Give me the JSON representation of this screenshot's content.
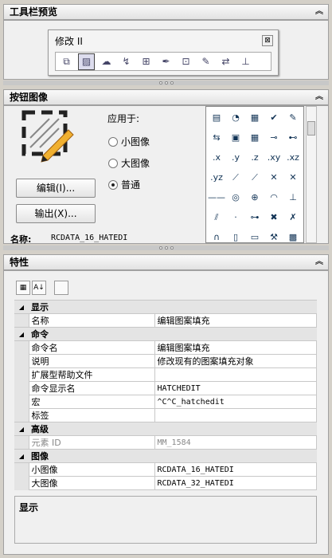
{
  "toolbar_preview": {
    "header": "工具栏预览",
    "window_title": "修改 II",
    "close_glyph": "⊠",
    "icons": [
      "draworder-icon",
      "edit-hatch-icon",
      "edit-polyline-icon",
      "edit-spline-icon",
      "edit-array-icon",
      "edit-text-icon",
      "edit-block-icon",
      "edit-attribute-icon",
      "sync-attribute-icon",
      "attribute-manager-icon"
    ]
  },
  "button_image": {
    "header": "按钮图像",
    "apply_to": "应用于:",
    "radios": [
      "小图像",
      "大图像",
      "普通"
    ],
    "selected": 2,
    "edit_button": "编辑(I)...",
    "export_button": "输出(X)...",
    "name_label": "名称:",
    "name_value": "RCDATA_16_HATEDI",
    "grid": [
      "▤",
      "◔",
      "▦",
      "✔",
      "✎",
      "⇆",
      "▣",
      "▦",
      "⊸",
      "⊷",
      ".x",
      ".y",
      ".z",
      ".xy",
      ".xz",
      ".yz",
      "⟋",
      "⟋",
      "✕",
      "✕",
      "——",
      "◎",
      "⊕",
      "◠",
      "⊥",
      "⫽",
      "·",
      "⊶",
      "✖",
      "✗",
      "∩",
      "▯",
      "▭",
      "⚒",
      "▩"
    ]
  },
  "properties": {
    "header": "特性",
    "sort_labels": [
      "▦",
      "A↓",
      ""
    ],
    "rows": [
      {
        "cat": true,
        "name": "显示"
      },
      {
        "name": "名称",
        "value": "编辑图案填充"
      },
      {
        "cat": true,
        "name": "命令"
      },
      {
        "name": "命令名",
        "value": "编辑图案填充"
      },
      {
        "name": "说明",
        "value": "修改现有的图案填充对象"
      },
      {
        "name": "扩展型帮助文件",
        "value": ""
      },
      {
        "name": "命令显示名",
        "value": "HATCHEDIT",
        "mono": true
      },
      {
        "name": "宏",
        "value": "^C^C_hatchedit",
        "mono": true
      },
      {
        "name": "标签",
        "value": ""
      },
      {
        "cat": true,
        "name": "高级"
      },
      {
        "name": "元素 ID",
        "value": "MM_1584",
        "mono": true,
        "gray": true
      },
      {
        "cat": true,
        "name": "图像"
      },
      {
        "name": "小图像",
        "value": "RCDATA_16_HATEDI",
        "mono": true
      },
      {
        "name": "大图像",
        "value": "RCDATA_32_HATEDI",
        "mono": true
      }
    ],
    "description_title": "显示"
  },
  "collapse_glyph": "︽"
}
